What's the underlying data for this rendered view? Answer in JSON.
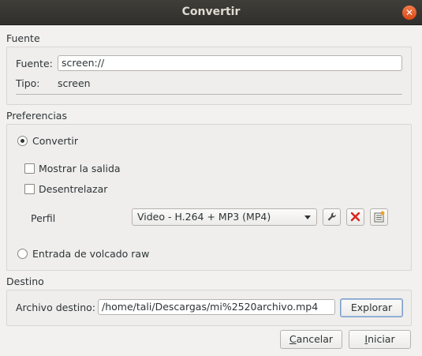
{
  "window": {
    "title": "Convertir",
    "close_icon": "window-close-icon",
    "accent": "#dd4814"
  },
  "source": {
    "section_label": "Fuente",
    "source_label": "Fuente:",
    "source_value": "screen://",
    "type_label": "Tipo:",
    "type_value": "screen"
  },
  "preferences": {
    "section_label": "Preferencias",
    "convert_label": "Convertir",
    "convert_checked": true,
    "show_output_label": "Mostrar la salida",
    "show_output_checked": false,
    "deinterlace_label": "Desentrelazar",
    "deinterlace_checked": false,
    "profile_label": "Perfil",
    "profile_selected": "Video - H.264 + MP3 (MP4)",
    "edit_profile_icon": "wrench-icon",
    "delete_profile_icon": "delete-x-icon",
    "new_profile_icon": "new-profile-icon",
    "raw_dump_label": "Entrada de volcado raw",
    "raw_dump_checked": false
  },
  "destination": {
    "section_label": "Destino",
    "file_label": "Archivo destino:",
    "file_value": "/home/tali/Descargas/mi%2520archivo.mp4",
    "browse_label": "Explorar"
  },
  "buttons": {
    "cancel_first": "C",
    "cancel_rest": "ancelar",
    "start_first": "I",
    "start_rest": "niciar"
  }
}
